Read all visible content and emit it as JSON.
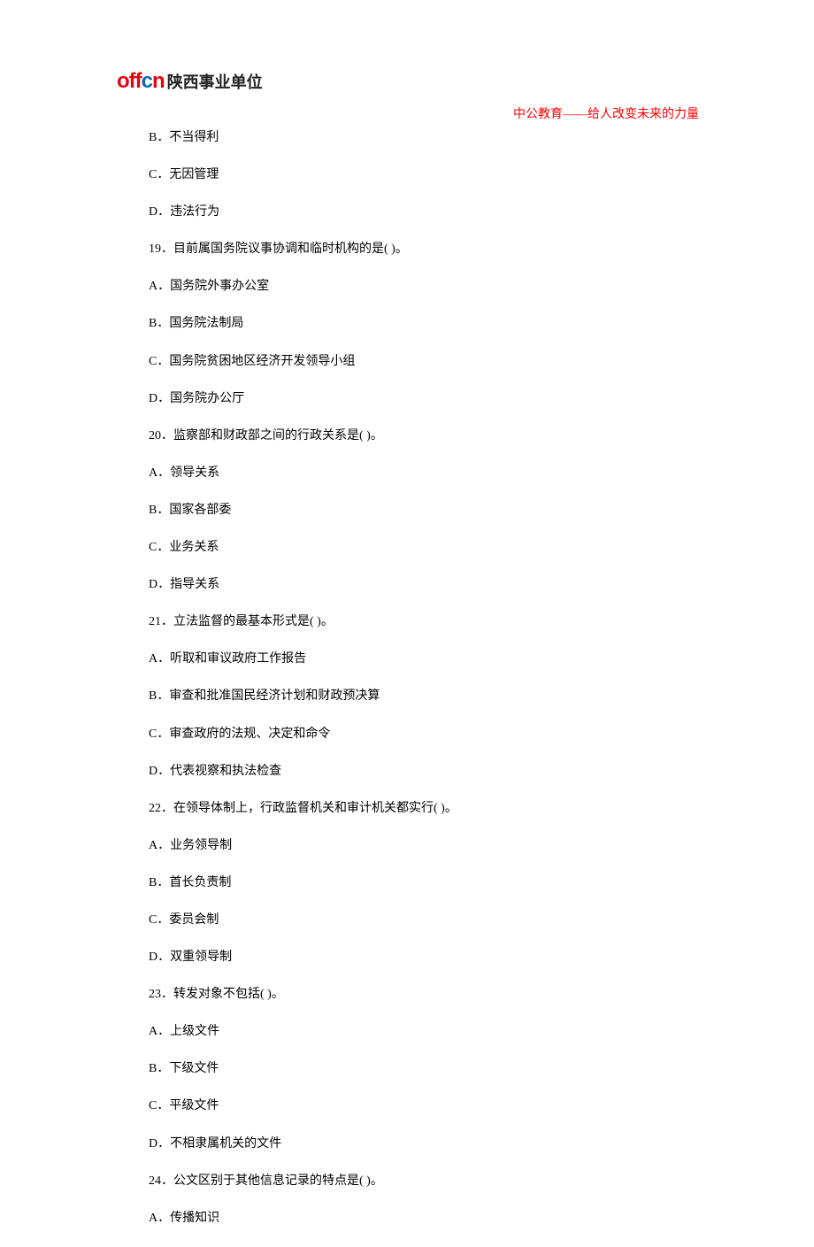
{
  "header": {
    "logo_prefix": "off",
    "logo_c": "c",
    "logo_n": "n",
    "logo_cn": "陕西事业单位",
    "tagline": "中公教育——给人改变未来的力量"
  },
  "lines": [
    "B．不当得利",
    "C．无因管理",
    "D．违法行为",
    "19．目前属国务院议事协调和临时机构的是(  )。",
    "A．国务院外事办公室",
    "B．国务院法制局",
    "C．国务院贫困地区经济开发领导小组",
    "D．国务院办公厅",
    "20．监察部和财政部之间的行政关系是(  )。",
    "A．领导关系",
    "B．国家各部委",
    "C．业务关系",
    "D．指导关系",
    "21．立法监督的最基本形式是(  )。",
    "A．听取和审议政府工作报告",
    "B．审查和批准国民经济计划和财政预决算",
    "C．审查政府的法规、决定和命令",
    "D．代表视察和执法检查",
    "22．在领导体制上，行政监督机关和审计机关都实行(  )。",
    "A．业务领导制",
    "B．首长负责制",
    "C．委员会制",
    "D．双重领导制",
    "23．转发对象不包括(  )。",
    "A．上级文件",
    "B．下级文件",
    "C．平级文件",
    "D．不相隶属机关的文件",
    "24．公文区别于其他信息记录的特点是(  )。",
    "A．传播知识"
  ]
}
